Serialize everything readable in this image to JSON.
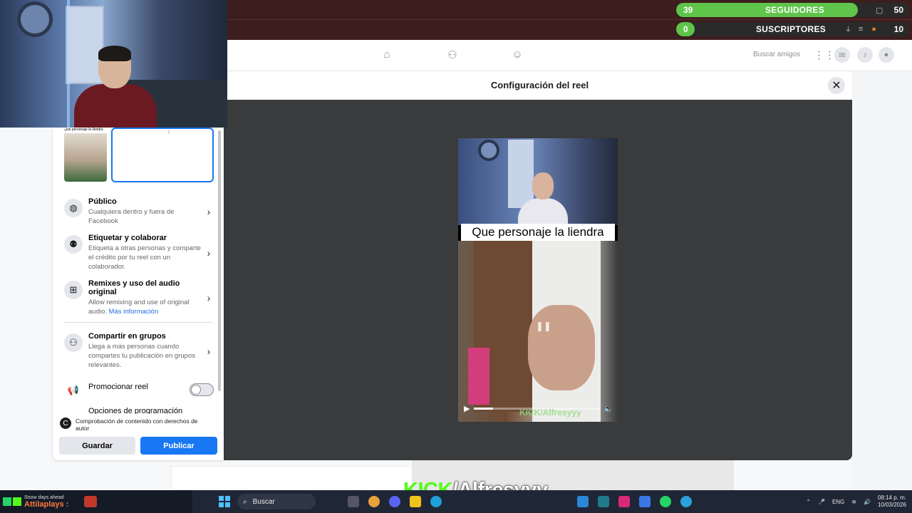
{
  "stream": {
    "followers": {
      "count": "39",
      "label": "SEGUIDORES",
      "goal": "50",
      "progress": 0.78
    },
    "subscribers": {
      "count": "0",
      "label": "SUSCRIPTORES",
      "goal": "10",
      "progress": 0.0
    }
  },
  "fb_header": {
    "search_friends": "Buscar amigos",
    "nav_icons": [
      "home-icon",
      "friends-icon",
      "groups-icon"
    ],
    "right_icons": [
      "menu-grid-icon",
      "messenger-icon",
      "bell-icon",
      "profile-icon"
    ]
  },
  "dialog": {
    "title": "Configuración del reel",
    "close_icon": "close-icon"
  },
  "video": {
    "caption": "Que personaje la liendra",
    "watermark": "KICK/Alfresyyy",
    "progress": 0.15
  },
  "panel": {
    "thumb_caption": "Que personaje la liendra",
    "options": [
      {
        "title": "Público",
        "desc": "Cualquiera dentro y fuera de Facebook",
        "icon": "globe-icon"
      },
      {
        "title": "Etiquetar y colaborar",
        "desc": "Etiqueta a otras personas y comparte el crédito por tu reel con un colaborador.",
        "icon": "people-icon"
      },
      {
        "title": "Remixes y uso del audio original",
        "desc": "Allow remixing and use of original audio.",
        "link": "Más información",
        "icon": "remix-icon"
      },
      {
        "title": "Compartir en grupos",
        "desc": "Llega a más personas cuando compartes tu publicación en grupos relevantes.",
        "icon": "groups-icon"
      },
      {
        "title": "Promocionar reel",
        "icon": "megaphone-icon",
        "toggle": false
      },
      {
        "title": "Opciones de programación"
      }
    ],
    "copyright": "Comprobación de contenido con derechos de autor",
    "save_label": "Guardar",
    "publish_label": "Publicar"
  },
  "overlay": {
    "kick_prefix": "KICK",
    "kick_name": "/Alfresyyy"
  },
  "taskbar": {
    "weather": "Snow days ahead",
    "streamer": "Attilaplays :",
    "search_placeholder": "Buscar",
    "lang": "ENG",
    "time": "08:14 p. m.",
    "date": "10/03/2026"
  },
  "colors": {
    "accent": "#1877f2",
    "kick_green": "#53fc18",
    "progress_green": "#5fc44a",
    "stream_bar": "#3d1e1e"
  }
}
